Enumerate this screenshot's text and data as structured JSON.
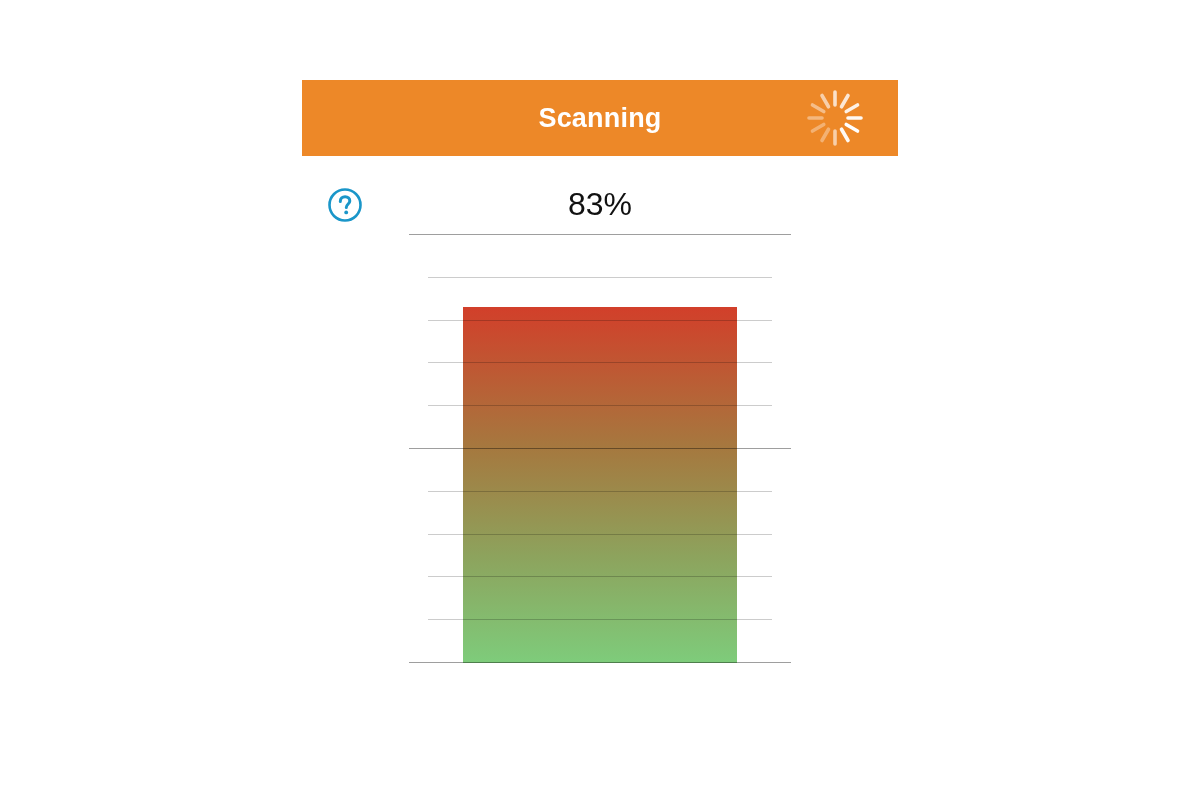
{
  "header": {
    "title": "Scanning",
    "busy": true
  },
  "progress": {
    "reading": "83%"
  },
  "meter": {
    "level": 0.83
  }
}
